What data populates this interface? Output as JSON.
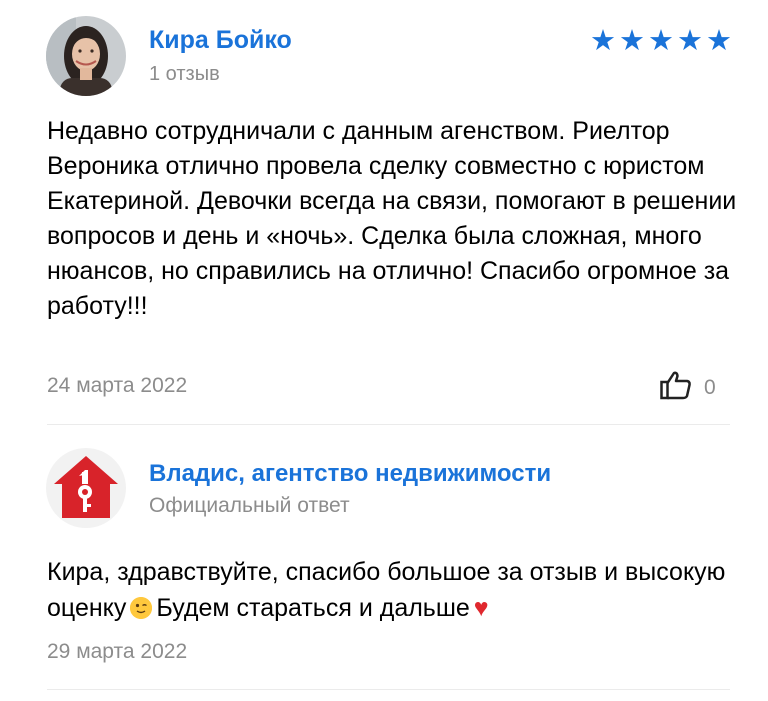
{
  "review": {
    "author_name": "Кира Бойко",
    "author_meta": "1 отзыв",
    "rating": 5,
    "star_glyph": "★",
    "text": "Недавно сотрудничали с данным агенством. Риелтор Вероника отлично провела сделку совместно с юристом Екатериной. Девочки всегда на связи, помогают в решении вопросов и день и «ночь». Сделка была сложная, много нюансов, но справились на отлично! Спасибо огромное за работу!!!",
    "date": "24 марта 2022",
    "likes": "0",
    "like_icon": "thumbs-up-icon"
  },
  "reply": {
    "org_name": "Владис, агентство недвижимости",
    "org_meta": "Официальный ответ",
    "text_part1": "Кира, здравствуйте, спасибо большое за отзыв и высокую оценку",
    "emoji_icon": "winking-face-icon",
    "text_part2": "Будем стараться и дальше",
    "heart_glyph": "♥",
    "date": "29 марта 2022"
  },
  "colors": {
    "accent": "#1a73d9",
    "muted": "#8c8c8c",
    "logo_red": "#d8232a",
    "heart_red": "#e0282e"
  }
}
